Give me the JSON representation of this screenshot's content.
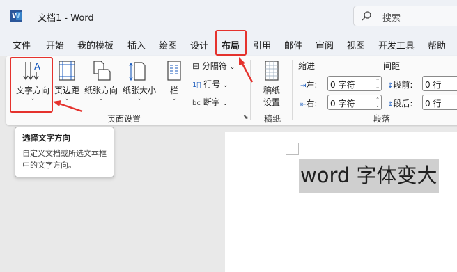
{
  "title_bar": {
    "doc_title": "文档1  -  Word",
    "search_placeholder": "搜索"
  },
  "tabs": [
    {
      "label": "文件"
    },
    {
      "label": "开始"
    },
    {
      "label": "我的模板"
    },
    {
      "label": "插入"
    },
    {
      "label": "绘图"
    },
    {
      "label": "设计"
    },
    {
      "label": "布局",
      "active": true
    },
    {
      "label": "引用"
    },
    {
      "label": "邮件"
    },
    {
      "label": "审阅"
    },
    {
      "label": "视图"
    },
    {
      "label": "开发工具"
    },
    {
      "label": "帮助"
    }
  ],
  "ribbon": {
    "page_setup": {
      "label": "页面设置",
      "text_direction": "文字方向",
      "margins": "页边距",
      "orientation": "纸张方向",
      "size": "纸张大小",
      "columns": "栏",
      "breaks": "分隔符",
      "line_numbers": "行号",
      "hyphenation": "断字"
    },
    "manuscript": {
      "label": "稿纸",
      "setup": "稿纸\n设置",
      "setup_line1": "稿纸",
      "setup_line2": "设置"
    },
    "paragraph": {
      "label": "段落",
      "indent_header": "缩进",
      "spacing_header": "间距",
      "left_label": "左:",
      "right_label": "右:",
      "before_label": "段前:",
      "after_label": "段后:",
      "left_value": "0 字符",
      "right_value": "0 字符",
      "before_value": "0 行",
      "after_value": "0 行"
    }
  },
  "tooltip": {
    "title": "选择文字方向",
    "description": "自定义文档或所选文本框中的文字方向。"
  },
  "document": {
    "text": "word 字体变大"
  },
  "colors": {
    "accent": "#185abd",
    "annotation_red": "#e5322d",
    "word_blue": "#2b579a"
  }
}
